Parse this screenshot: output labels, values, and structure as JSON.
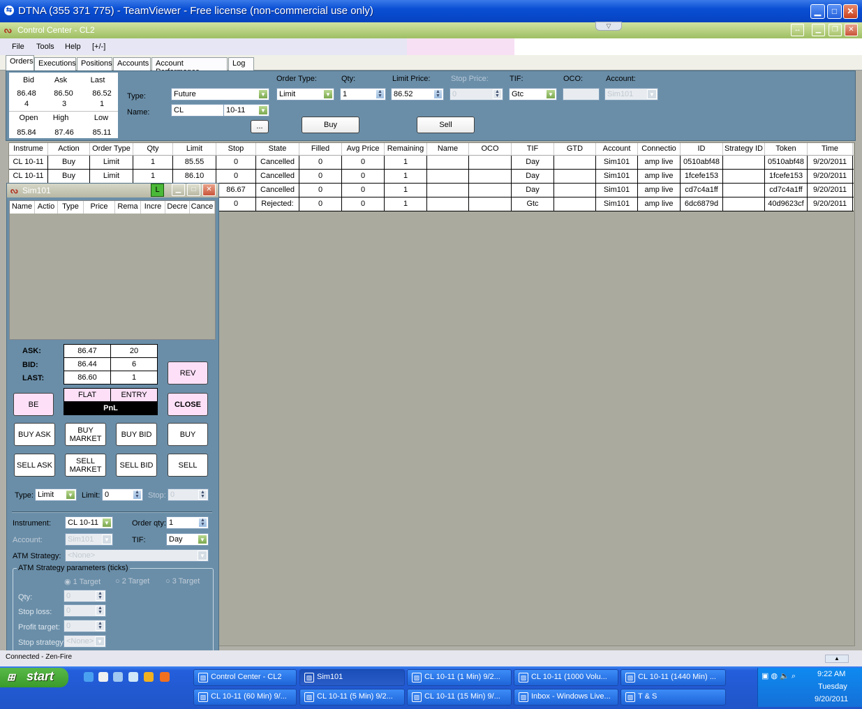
{
  "teamviewer": {
    "title": "DTNA (355 371 775) - TeamViewer - Free license (non-commercial use only)"
  },
  "app": {
    "title": "Control Center - CL2"
  },
  "menu": [
    "File",
    "Tools",
    "Help",
    "[+/-]"
  ],
  "tabs": [
    "Orders",
    "Executions",
    "Positions",
    "Accounts",
    "Account Performance",
    "Log"
  ],
  "market": {
    "bid_label": "Bid",
    "ask_label": "Ask",
    "last_label": "Last",
    "bid": "86.48",
    "ask": "86.50",
    "last": "86.52",
    "bid_size": "4",
    "ask_size": "3",
    "last_size": "1",
    "open_label": "Open",
    "high_label": "High",
    "low_label": "Low",
    "open": "85.84",
    "high": "87.46",
    "low": "85.11"
  },
  "order_entry": {
    "type_label": "Type:",
    "name_label": "Name:",
    "type_value": "Future",
    "name_value": "CL",
    "expiry_value": "10-11",
    "ellipsis": "...",
    "order_type_label": "Order Type:",
    "order_type_value": "Limit",
    "qty_label": "Qty:",
    "qty_value": "1",
    "limit_label": "Limit Price:",
    "limit_value": "86.52",
    "stop_label": "Stop Price:",
    "stop_value": "0",
    "tif_label": "TIF:",
    "tif_value": "Gtc",
    "oco_label": "OCO:",
    "oco_value": "",
    "account_label": "Account:",
    "account_value": "Sim101",
    "buy": "Buy",
    "sell": "Sell"
  },
  "orders_grid": {
    "columns": [
      "Instrume",
      "Action",
      "Order Type",
      "Qty",
      "Limit",
      "Stop",
      "State",
      "Filled",
      "Avg Price",
      "Remaining",
      "Name",
      "OCO",
      "TIF",
      "GTD",
      "Account",
      "Connectio",
      "ID",
      "Strategy ID",
      "Token",
      "Time"
    ],
    "rows": [
      [
        "CL 10-11",
        "Buy",
        "Limit",
        "1",
        "85.55",
        "0",
        "Cancelled",
        "0",
        "0",
        "1",
        "",
        "",
        "Day",
        "",
        "Sim101",
        "amp live",
        "0510abf48",
        "",
        "0510abf48",
        "9/20/2011"
      ],
      [
        "CL 10-11",
        "Buy",
        "Limit",
        "1",
        "86.10",
        "0",
        "Cancelled",
        "0",
        "0",
        "1",
        "",
        "",
        "Day",
        "",
        "Sim101",
        "amp live",
        "1fcefe153",
        "",
        "1fcefe153",
        "9/20/2011"
      ],
      [
        "",
        "",
        "",
        "",
        "",
        "86.67",
        "Cancelled",
        "0",
        "0",
        "1",
        "",
        "",
        "Day",
        "",
        "Sim101",
        "amp live",
        "cd7c4a1ff",
        "",
        "cd7c4a1ff",
        "9/20/2011"
      ],
      [
        "",
        "",
        "",
        "",
        "",
        "0",
        "Rejected:",
        "0",
        "0",
        "1",
        "",
        "",
        "Gtc",
        "",
        "Sim101",
        "amp live",
        "6dc6879d",
        "",
        "40d9623cf",
        "9/20/2011"
      ]
    ]
  },
  "sim": {
    "title": "Sim101",
    "l_badge": "L",
    "columns": [
      "Name",
      "Actio",
      "Type",
      "Price",
      "Rema",
      "Incre",
      "Decre",
      "Cance"
    ],
    "ask_label": "ASK:",
    "bid_label": "BID:",
    "last_label": "LAST:",
    "ask": "86.47",
    "ask_size": "20",
    "bid": "86.44",
    "bid_size": "6",
    "last": "86.60",
    "last_size": "1",
    "flat": "FLAT",
    "entry": "ENTRY",
    "pnl": "PnL",
    "rev": "REV",
    "be": "BE",
    "close": "CLOSE",
    "buy_ask": "BUY ASK",
    "buy_market": "BUY MARKET",
    "buy_bid": "BUY BID",
    "buy": "BUY",
    "sell_ask": "SELL ASK",
    "sell_market": "SELL MARKET",
    "sell_bid": "SELL BID",
    "sell": "SELL",
    "type_label": "Type:",
    "type_value": "Limit",
    "limit_label": "Limit:",
    "limit_value": "0",
    "stop_label": "Stop:",
    "stop_value": "0",
    "instrument_label": "Instrument:",
    "instrument_value": "CL 10-11",
    "order_qty_label": "Order qty:",
    "order_qty_value": "1",
    "account_label": "Account:",
    "account_value": "Sim101",
    "tif_label": "TIF:",
    "tif_value": "Day",
    "atm_label": "ATM Strategy:",
    "atm_value": "<None>",
    "atm_params_label": "ATM Strategy parameters (ticks)",
    "target1": "1 Target",
    "target2": "2 Target",
    "target3": "3 Target",
    "qty_label": "Qty:",
    "qty_value": "0",
    "stop_loss_label": "Stop loss:",
    "stop_loss_value": "0",
    "profit_label": "Profit target:",
    "profit_value": "0",
    "stop_strategy_label": "Stop strategy:",
    "stop_strategy_value": "<None>"
  },
  "status": {
    "text": "Connected - Zen-Fire"
  },
  "taskbar": {
    "start": "start",
    "row1": [
      "Control Center - CL2",
      "Sim101",
      "CL 10-11 (1 Min)  9/2...",
      "CL 10-11 (1000 Volu...",
      "CL 10-11 (1440 Min)  ..."
    ],
    "row2": [
      "CL 10-11 (60 Min)  9/...",
      "CL 10-11 (5 Min)  9/2...",
      "CL 10-11 (15 Min)  9/...",
      "Inbox - Windows Live...",
      "T & S"
    ],
    "time": "9:22 AM",
    "day": "Tuesday",
    "date": "9/20/2011"
  }
}
